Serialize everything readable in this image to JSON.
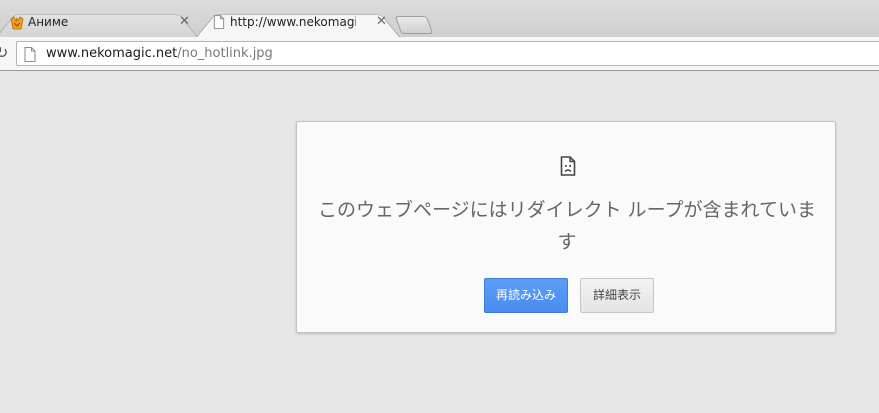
{
  "tabs": [
    {
      "title": "Аниме",
      "favicon": "anime-favicon-icon",
      "active": false
    },
    {
      "title": "http://www.nekomagic.net/no_hotlink.jpg",
      "favicon": "page-icon",
      "active": true
    }
  ],
  "omnibox": {
    "host": "www.nekomagic.net",
    "path": "/no_hotlink.jpg"
  },
  "error": {
    "icon": "sad-page-icon",
    "heading": "このウェブページにはリダイレクト ループが含まれています",
    "reload_label": "再読み込み",
    "details_label": "詳細表示"
  },
  "colors": {
    "primary_button": "#4a8cf0",
    "page_background": "#e6e6e6",
    "card_background": "#fafafa"
  }
}
